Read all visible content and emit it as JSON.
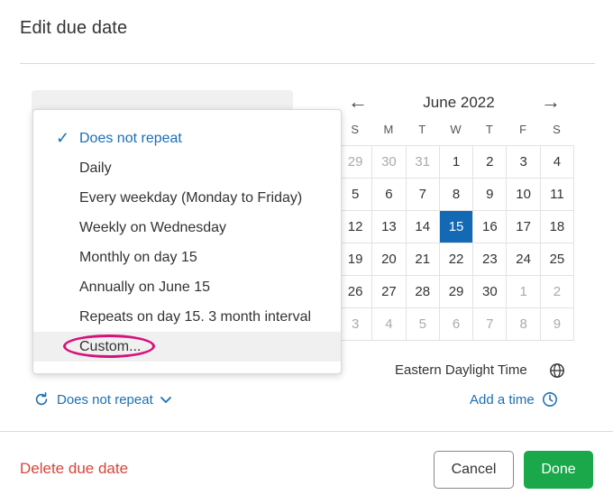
{
  "dialog": {
    "title": "Edit due date"
  },
  "calendar": {
    "month_label": "June 2022",
    "prev_icon": "←",
    "next_icon": "→",
    "weekdays": [
      "S",
      "M",
      "T",
      "W",
      "T",
      "F",
      "S"
    ],
    "days": [
      {
        "d": "29",
        "m": true
      },
      {
        "d": "30",
        "m": true
      },
      {
        "d": "31",
        "m": true
      },
      {
        "d": "1"
      },
      {
        "d": "2"
      },
      {
        "d": "3"
      },
      {
        "d": "4"
      },
      {
        "d": "5"
      },
      {
        "d": "6"
      },
      {
        "d": "7"
      },
      {
        "d": "8"
      },
      {
        "d": "9"
      },
      {
        "d": "10"
      },
      {
        "d": "11"
      },
      {
        "d": "12"
      },
      {
        "d": "13"
      },
      {
        "d": "14"
      },
      {
        "d": "15",
        "sel": true
      },
      {
        "d": "16"
      },
      {
        "d": "17"
      },
      {
        "d": "18"
      },
      {
        "d": "19"
      },
      {
        "d": "20"
      },
      {
        "d": "21"
      },
      {
        "d": "22"
      },
      {
        "d": "23"
      },
      {
        "d": "24"
      },
      {
        "d": "25"
      },
      {
        "d": "26"
      },
      {
        "d": "27"
      },
      {
        "d": "28"
      },
      {
        "d": "29"
      },
      {
        "d": "30"
      },
      {
        "d": "1",
        "m": true
      },
      {
        "d": "2",
        "m": true
      },
      {
        "d": "3",
        "m": true
      },
      {
        "d": "4",
        "m": true
      },
      {
        "d": "5",
        "m": true
      },
      {
        "d": "6",
        "m": true
      },
      {
        "d": "7",
        "m": true
      },
      {
        "d": "8",
        "m": true
      },
      {
        "d": "9",
        "m": true
      }
    ],
    "selected_color": "#1369b4"
  },
  "repeat_menu": {
    "check_icon": "✓",
    "options": [
      "Does not repeat",
      "Daily",
      "Every weekday (Monday to Friday)",
      "Weekly on Wednesday",
      "Monthly on day 15",
      "Annually on June 15",
      "Repeats on day 15. 3 month interval",
      "Custom..."
    ],
    "checked_index": 0,
    "highlight_color": "#d6127c"
  },
  "timezone": {
    "label": "Eastern Daylight Time",
    "icon": "globe-icon"
  },
  "repeat_toggle": {
    "label": "Does not repeat",
    "icon": "repeat-icon",
    "chevron": "chevron-down-icon"
  },
  "add_time": {
    "label": "Add a time",
    "icon": "clock-icon"
  },
  "footer": {
    "delete_label": "Delete due date",
    "cancel_label": "Cancel",
    "done_label": "Done",
    "done_color": "#1aa84b",
    "delete_color": "#d9453a"
  }
}
